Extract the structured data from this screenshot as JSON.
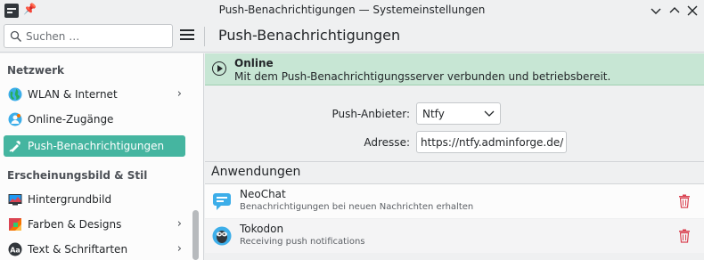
{
  "window": {
    "title": "Push-Benachrichtigungen — Systemeinstellungen"
  },
  "toolbar": {
    "search_placeholder": "Suchen …",
    "page_title": "Push-Benachrichtigungen"
  },
  "sidebar": {
    "sections": [
      {
        "header": "Netzwerk"
      },
      {
        "header": "Erscheinungsbild & Stil"
      }
    ],
    "items": [
      {
        "label": "WLAN & Internet",
        "icon": "globe-icon",
        "has_children": true
      },
      {
        "label": "Online-Zugänge",
        "icon": "online-accounts-icon",
        "has_children": false
      },
      {
        "label": "Push-Benachrichtigungen",
        "icon": "push-notifications-icon",
        "has_children": false,
        "active": true
      },
      {
        "label": "Hintergrundbild",
        "icon": "wallpaper-icon",
        "has_children": false
      },
      {
        "label": "Farben & Designs",
        "icon": "palette-icon",
        "has_children": true
      },
      {
        "label": "Text & Schriftarten",
        "icon": "fonts-icon",
        "has_children": true
      }
    ]
  },
  "status": {
    "title": "Online",
    "message": "Mit dem Push-Benachrichtigungsserver verbunden und betriebsbereit."
  },
  "form": {
    "provider_label": "Push-Anbieter:",
    "provider_value": "Ntfy",
    "address_label": "Adresse:",
    "address_value": "https://ntfy.adminforge.de/"
  },
  "applications": {
    "header": "Anwendungen",
    "items": [
      {
        "name": "NeoChat",
        "description": "Benachrichtigungen bei neuen Nachrichten erhalten",
        "icon": "neochat-icon"
      },
      {
        "name": "Tokodon",
        "description": "Receiving push notifications",
        "icon": "tokodon-icon"
      }
    ]
  },
  "colors": {
    "accent": "#45b5a0",
    "banner_bg": "#c7e6d4",
    "delete": "#da4453"
  }
}
